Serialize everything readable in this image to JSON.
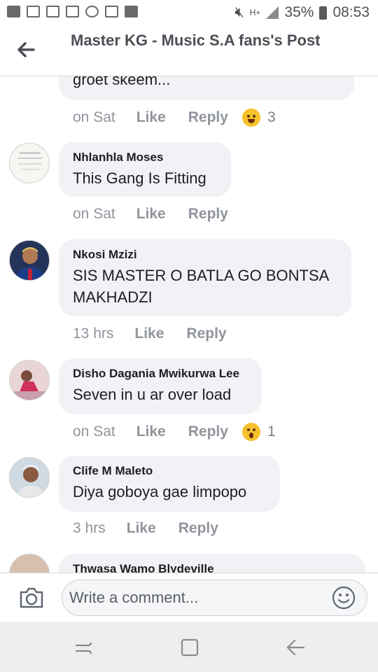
{
  "status_bar": {
    "battery": "35%",
    "time": "08:53"
  },
  "header": {
    "title": "Master KG - Music S.A fans's Post"
  },
  "comments": [
    {
      "text": "groet skeem...",
      "time": "on Sat",
      "like": "Like",
      "reply": "Reply",
      "reaction_count": "3"
    },
    {
      "author": "Nhlanhla Moses",
      "text": "This Gang Is Fitting",
      "time": "on Sat",
      "like": "Like",
      "reply": "Reply"
    },
    {
      "author": "Nkosi Mzizi",
      "text": "SIS MASTER O BATLA GO BONTSA MAKHADZI",
      "time": "13 hrs",
      "like": "Like",
      "reply": "Reply"
    },
    {
      "author": "Disho Dagania Mwikurwa Lee",
      "text": "Seven in u ar over load",
      "time": "on Sat",
      "like": "Like",
      "reply": "Reply",
      "reaction_count": "1"
    },
    {
      "author": "Clife M Maleto",
      "text": "Diya goboya gae  limpopo",
      "time": "3 hrs",
      "like": "Like",
      "reply": "Reply"
    },
    {
      "author": "Thwasa Wamo Blydeville"
    }
  ],
  "composer": {
    "placeholder": "Write a comment..."
  },
  "icons": {
    "back": "arrow-left-icon",
    "camera": "camera-icon",
    "smiley": "smiley-icon",
    "laugh": "laughing-emoji-icon",
    "wow": "wow-emoji-icon",
    "recents": "recents-icon",
    "home": "home-icon",
    "nav_back": "nav-back-icon"
  },
  "colors": {
    "bubble": "#f0f2f5",
    "meta_text": "#90949c",
    "title": "#4b4f56",
    "emoji": "#f7c12b"
  }
}
